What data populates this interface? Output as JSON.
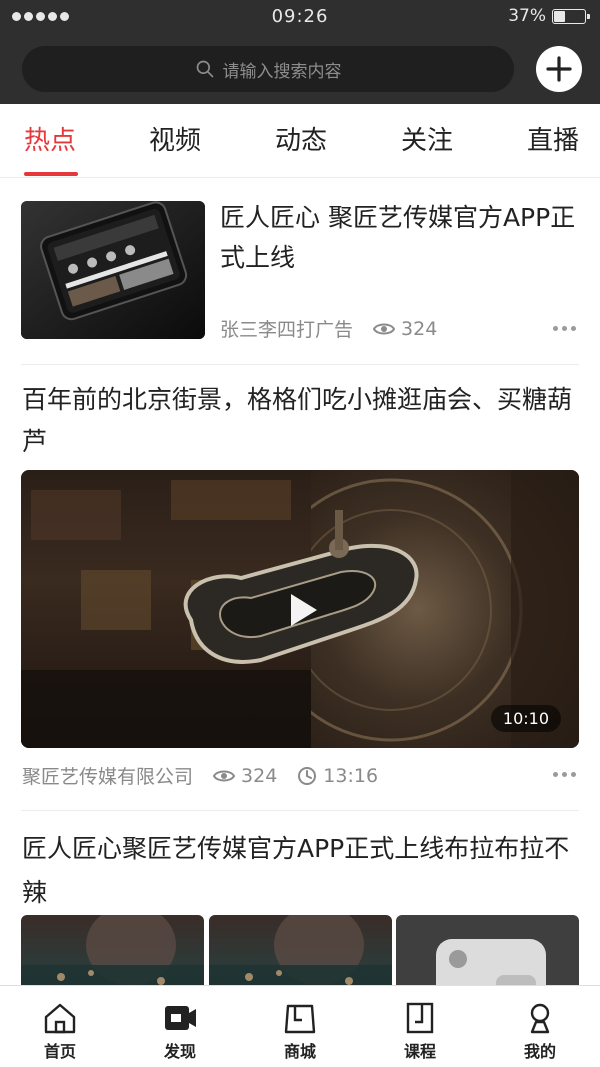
{
  "status_bar": {
    "time": "09:26",
    "battery": "37%",
    "battery_level": 0.37
  },
  "header": {
    "search_placeholder": "请输入搜索内容"
  },
  "tabs": [
    {
      "label": "热点",
      "active": true
    },
    {
      "label": "视频",
      "active": false
    },
    {
      "label": "动态",
      "active": false
    },
    {
      "label": "关注",
      "active": false
    },
    {
      "label": "直播",
      "active": false
    }
  ],
  "feed": {
    "article1": {
      "title": "匠人匠心 聚匠艺传媒官方APP正式上线",
      "author": "张三李四打广告",
      "views": "324"
    },
    "article2": {
      "title": "百年前的北京街景，格格们吃小摊逛庙会、买糖葫芦",
      "duration": "10:10",
      "author": "聚匠艺传媒有限公司",
      "views": "324",
      "time": "13:16"
    },
    "article3": {
      "title": "匠人匠心聚匠艺传媒官方APP正式上线布拉布拉不辣"
    }
  },
  "bottom_nav": [
    {
      "label": "首页",
      "icon": "home-icon"
    },
    {
      "label": "发现",
      "icon": "video-camera-icon"
    },
    {
      "label": "商城",
      "icon": "shopping-bag-icon"
    },
    {
      "label": "课程",
      "icon": "course-book-icon"
    },
    {
      "label": "我的",
      "icon": "user-icon"
    }
  ],
  "colors": {
    "accent": "#e5383b",
    "header_bg": "#2f2f2f"
  }
}
